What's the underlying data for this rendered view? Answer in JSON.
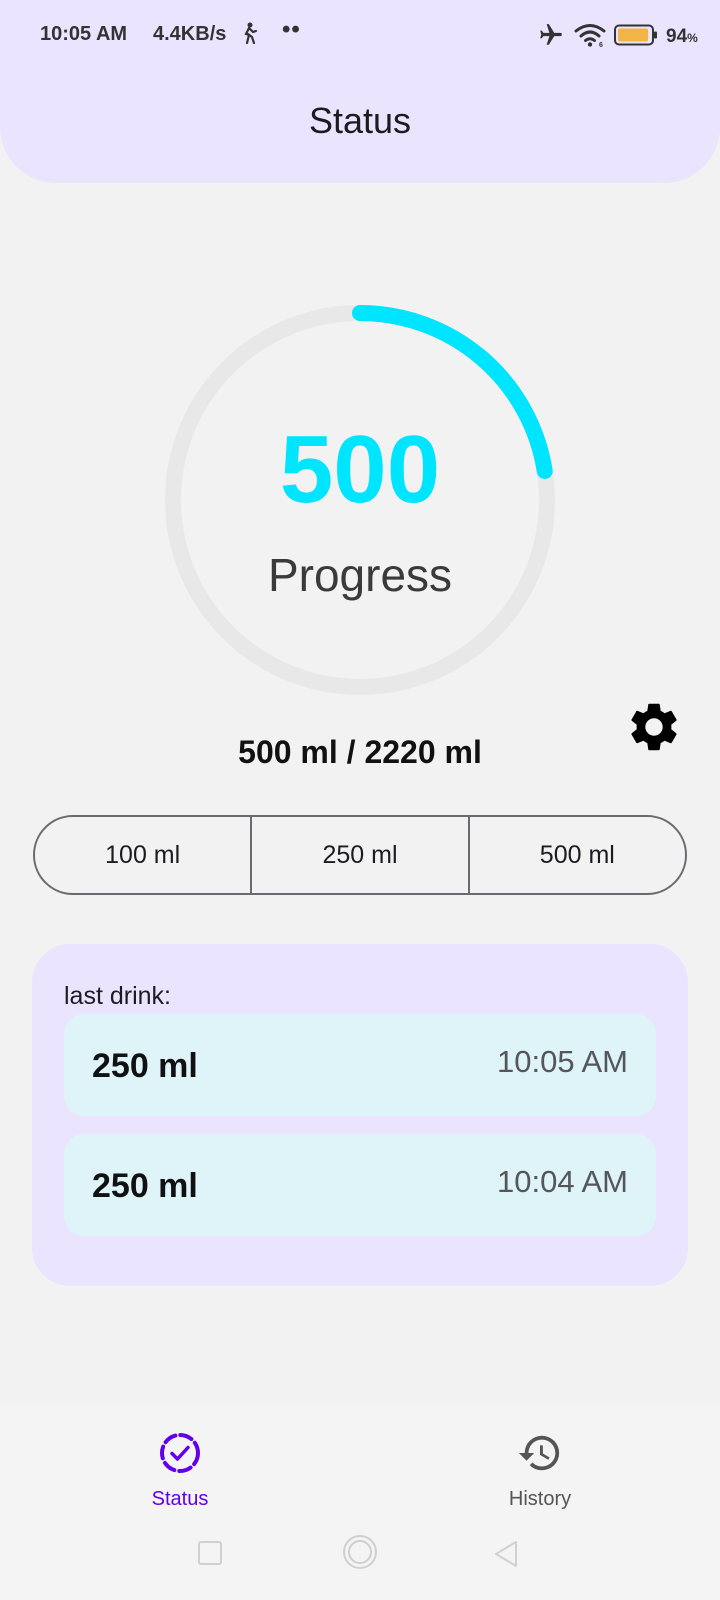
{
  "status_bar": {
    "time": "10:05 AM",
    "net_speed": "4.4KB/s",
    "dots": "••",
    "battery_percent": "94",
    "battery_unit": "%",
    "battery_level": 0.94,
    "icons": [
      "person-icon",
      "airplane-mode-icon",
      "wifi-icon",
      "battery-icon"
    ]
  },
  "header": {
    "title": "Status"
  },
  "progress": {
    "value": "500",
    "label": "Progress",
    "consumed_ml": 500,
    "goal_ml": 2220,
    "summary": "500 ml / 2220 ml",
    "ring_color": "#00e5ff",
    "track_color": "#e8e8e8"
  },
  "quick_add": {
    "options": [
      "100 ml",
      "250 ml",
      "500 ml"
    ]
  },
  "last_drink": {
    "label": "last drink:",
    "items": [
      {
        "amount": "250 ml",
        "time": "10:05 AM"
      },
      {
        "amount": "250 ml",
        "time": "10:04 AM"
      }
    ]
  },
  "bottom_nav": {
    "items": [
      {
        "label": "Status",
        "icon": "status-check-icon",
        "active": true
      },
      {
        "label": "History",
        "icon": "history-icon",
        "active": false
      }
    ],
    "active_color": "#6200ee"
  }
}
